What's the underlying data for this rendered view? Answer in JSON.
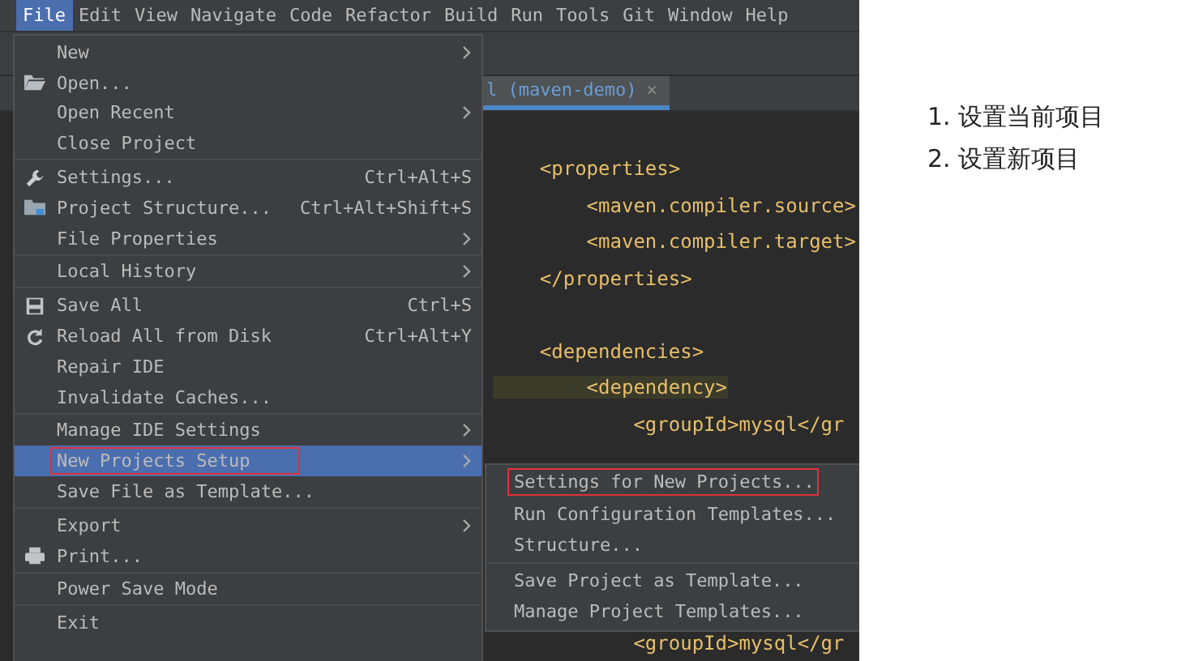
{
  "menubar": [
    {
      "label": "File",
      "selected": true
    },
    {
      "label": "Edit",
      "selected": false
    },
    {
      "label": "View",
      "selected": false
    },
    {
      "label": "Navigate",
      "selected": false
    },
    {
      "label": "Code",
      "selected": false
    },
    {
      "label": "Refactor",
      "selected": false
    },
    {
      "label": "Build",
      "selected": false
    },
    {
      "label": "Run",
      "selected": false
    },
    {
      "label": "Tools",
      "selected": false
    },
    {
      "label": "Git",
      "selected": false
    },
    {
      "label": "Window",
      "selected": false
    },
    {
      "label": "Help",
      "selected": false
    }
  ],
  "editor_tab": {
    "label": "l (maven-demo)",
    "close": "×"
  },
  "code_lines": [
    {
      "text": "    <properties>",
      "highlighted": false
    },
    {
      "text": "        <maven.compiler.source>",
      "highlighted": false
    },
    {
      "text": "        <maven.compiler.target>",
      "highlighted": false
    },
    {
      "text": "    </properties>",
      "highlighted": false
    },
    {
      "text": "    <dependencies>",
      "highlighted": false
    },
    {
      "text": "        <dependency>",
      "highlighted": true
    },
    {
      "text": "            <groupId>mysql</gr",
      "highlighted": false
    },
    {
      "text": "            <groupId>mysql</gr",
      "highlighted": false
    }
  ],
  "file_menu": {
    "items": [
      {
        "kind": "item",
        "label": "New",
        "has_submenu": true,
        "selected": false,
        "annotated": false
      },
      {
        "kind": "item",
        "label": "Open...",
        "has_submenu": false,
        "selected": false,
        "annotated": false
      },
      {
        "kind": "item",
        "label": "Open Recent",
        "has_submenu": true,
        "selected": false,
        "annotated": false
      },
      {
        "kind": "item",
        "label": "Close Project",
        "has_submenu": false,
        "selected": false,
        "annotated": false
      },
      {
        "kind": "separator"
      },
      {
        "kind": "item",
        "label": "Settings...",
        "shortcut": "Ctrl+Alt+S",
        "has_submenu": false,
        "selected": false,
        "annotated": false
      },
      {
        "kind": "item",
        "label": "Project Structure...",
        "shortcut": "Ctrl+Alt+Shift+S",
        "has_submenu": false,
        "selected": false,
        "annotated": false
      },
      {
        "kind": "item",
        "label": "File Properties",
        "has_submenu": true,
        "selected": false,
        "annotated": false
      },
      {
        "kind": "separator"
      },
      {
        "kind": "item",
        "label": "Local History",
        "has_submenu": true,
        "selected": false,
        "annotated": false
      },
      {
        "kind": "separator"
      },
      {
        "kind": "item",
        "label": "Save All",
        "shortcut": "Ctrl+S",
        "has_submenu": false,
        "selected": false,
        "annotated": false
      },
      {
        "kind": "item",
        "label": "Reload All from Disk",
        "shortcut": "Ctrl+Alt+Y",
        "has_submenu": false,
        "selected": false,
        "annotated": false
      },
      {
        "kind": "item",
        "label": "Repair IDE",
        "has_submenu": false,
        "selected": false,
        "annotated": false
      },
      {
        "kind": "item",
        "label": "Invalidate Caches...",
        "has_submenu": false,
        "selected": false,
        "annotated": false
      },
      {
        "kind": "separator"
      },
      {
        "kind": "item",
        "label": "Manage IDE Settings",
        "has_submenu": true,
        "selected": false,
        "annotated": false
      },
      {
        "kind": "item",
        "label": "New Projects Setup",
        "has_submenu": true,
        "selected": true,
        "annotated": true
      },
      {
        "kind": "item",
        "label": "Save File as Template...",
        "has_submenu": false,
        "selected": false,
        "annotated": false
      },
      {
        "kind": "separator"
      },
      {
        "kind": "item",
        "label": "Export",
        "has_submenu": true,
        "selected": false,
        "annotated": false
      },
      {
        "kind": "item",
        "label": "Print...",
        "has_submenu": false,
        "selected": false,
        "annotated": false
      },
      {
        "kind": "separator"
      },
      {
        "kind": "item",
        "label": "Power Save Mode",
        "has_submenu": false,
        "selected": false,
        "annotated": false
      },
      {
        "kind": "separator"
      },
      {
        "kind": "item",
        "label": "Exit",
        "has_submenu": false,
        "selected": false,
        "annotated": false
      }
    ]
  },
  "submenu": {
    "items": [
      {
        "kind": "item",
        "label": "Settings for New Projects...",
        "annotated": true
      },
      {
        "kind": "item",
        "label": "Run Configuration Templates...",
        "annotated": false
      },
      {
        "kind": "item",
        "label": "Structure...",
        "annotated": false
      },
      {
        "kind": "separator"
      },
      {
        "kind": "item",
        "label": "Save Project as Template...",
        "annotated": false
      },
      {
        "kind": "item",
        "label": "Manage Project Templates...",
        "annotated": false
      }
    ]
  },
  "notes": [
    "1. 设置当前项目",
    "2. 设置新项目"
  ]
}
